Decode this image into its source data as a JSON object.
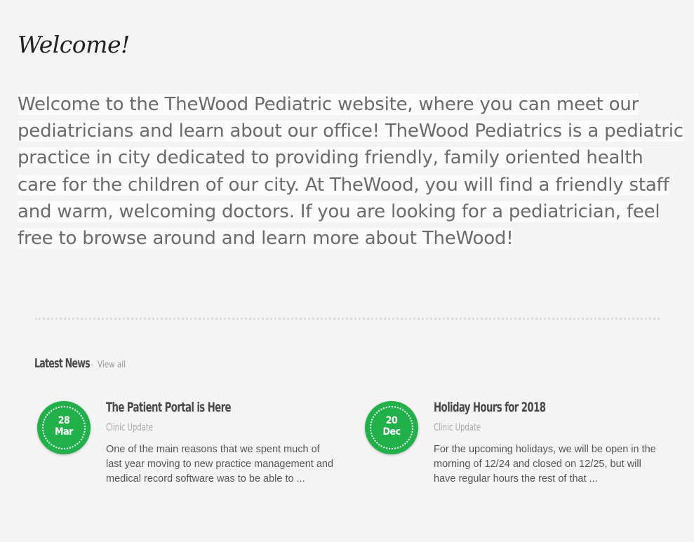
{
  "welcome": {
    "title": "Welcome!",
    "intro": "Welcome to the TheWood Pediatric website, where you can meet our pediatricians and learn about our office! TheWood Pediatrics is a pediatric practice in city dedicated to providing friendly, family oriented health care for the children of our city. At TheWood, you will find a friendly staff and warm, welcoming doctors. If you are looking for a pediatrician, feel free to browse around and learn more about TheWood!"
  },
  "news": {
    "title": "Latest News",
    "separator": "-",
    "view_all": "View all",
    "items": [
      {
        "day": "28",
        "month": "Mar",
        "headline": "The Patient Portal is Here",
        "category": "Clinic Update",
        "excerpt": "One of the main reasons that we spent much of last year moving to new practice management and medical record software was to be able to ..."
      },
      {
        "day": "20",
        "month": "Dec",
        "headline": "Holiday Hours for 2018",
        "category": "Clinic Update",
        "excerpt": "For the upcoming holidays, we will be open in the morning of 12/24 and closed on 12/25, but will have regular hours the rest of that ..."
      }
    ]
  },
  "colors": {
    "accent_green": "#22b04a",
    "background": "#f4f4f4",
    "heading_dark": "#4a4a4a",
    "muted_gray": "#a9a9a9"
  }
}
